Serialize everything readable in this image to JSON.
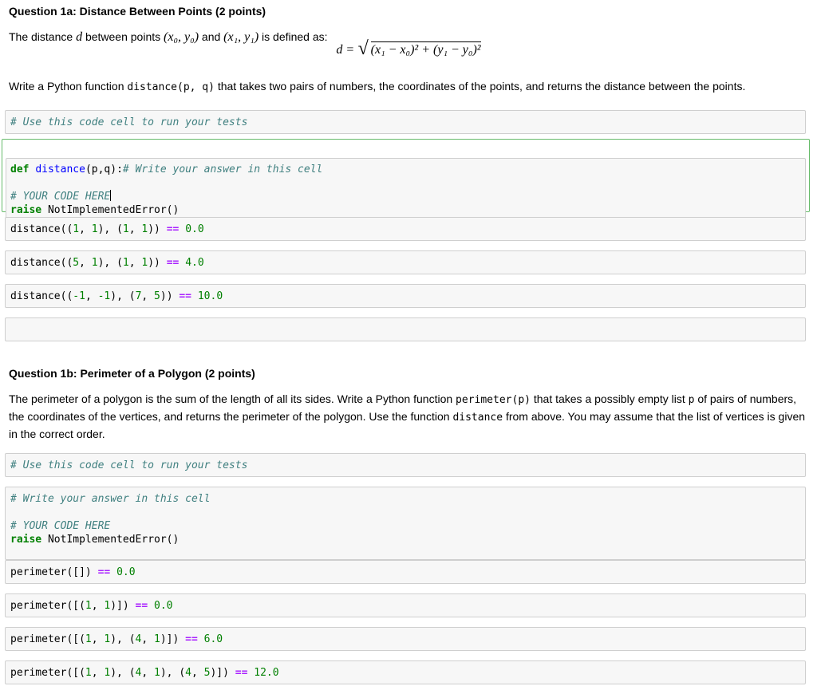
{
  "q1a": {
    "title": "Question 1a: Distance Between Points (2 points)",
    "intro_prefix": "The distance ",
    "intro_d": "d",
    "intro_mid": " between points ",
    "p0": "(x₀, y₀)",
    "intro_and": " and ",
    "p1": "(x₁, y₁)",
    "intro_suffix": " is defined as:",
    "formula_lhs": "d =",
    "formula_rad": "(x₁ − x₀)² + (y₁ − y₀)²",
    "task_prefix": "Write a Python function ",
    "task_code": "distance(p, q)",
    "task_suffix": " that takes two pairs of numbers, the coordinates of the points, and returns the distance between the points.",
    "test_cell_comment": "# Use this code cell to run your tests",
    "answer": {
      "def_kw": "def",
      "func_name": "distance",
      "params": "(p,q):",
      "comment1": "# Write your answer in this cell",
      "comment2": "# YOUR CODE HERE",
      "raise_kw": "raise",
      "error": " NotImplementedError()"
    },
    "tests": [
      {
        "call": "distance((",
        "parts": [
          "1",
          ", ",
          "1",
          "), (",
          "1",
          ", ",
          "1",
          "))"
        ],
        "op": "==",
        "result": "0.0"
      },
      {
        "call": "distance((",
        "parts": [
          "5",
          ", ",
          "1",
          "), (",
          "1",
          ", ",
          "1",
          "))"
        ],
        "op": "==",
        "result": "4.0"
      },
      {
        "call": "distance((",
        "parts": [
          "-1",
          ", ",
          "-1",
          "), (",
          "7",
          ", ",
          "5",
          "))"
        ],
        "op": "==",
        "result": "10.0"
      }
    ]
  },
  "q1b": {
    "title": "Question 1b: Perimeter of a Polygon (2 points)",
    "desc_1": "The perimeter of a polygon is the sum of the length of all its sides. Write a Python function ",
    "desc_code1": "perimeter(p)",
    "desc_2": " that takes a possibly empty list ",
    "desc_code2": "p",
    "desc_3": " of pairs of numbers, the coordinates of the vertices, and returns the perimeter of the polygon. Use the function ",
    "desc_code3": "distance",
    "desc_4": " from above. You may assume that the list of vertices is given in the correct order.",
    "test_cell_comment": "# Use this code cell to run your tests",
    "answer": {
      "comment1": "# Write your answer in this cell",
      "comment2": "# YOUR CODE HERE",
      "raise_kw": "raise",
      "error": " NotImplementedError()"
    },
    "tests": [
      {
        "code": "perimeter([])",
        "op": "==",
        "result": "0.0"
      },
      {
        "code_pre": "perimeter([(",
        "nums": [
          "1",
          "1"
        ],
        "code_post": ")])",
        "op": "==",
        "result": "0.0"
      },
      {
        "code_pre": "perimeter([(",
        "nums": [
          "1",
          "1",
          "4",
          "1"
        ],
        "op": "==",
        "result": "6.0"
      },
      {
        "code_pre": "perimeter([(",
        "nums": [
          "1",
          "1",
          "4",
          "1",
          "4",
          "5"
        ],
        "op": "==",
        "result": "12.0"
      }
    ]
  }
}
